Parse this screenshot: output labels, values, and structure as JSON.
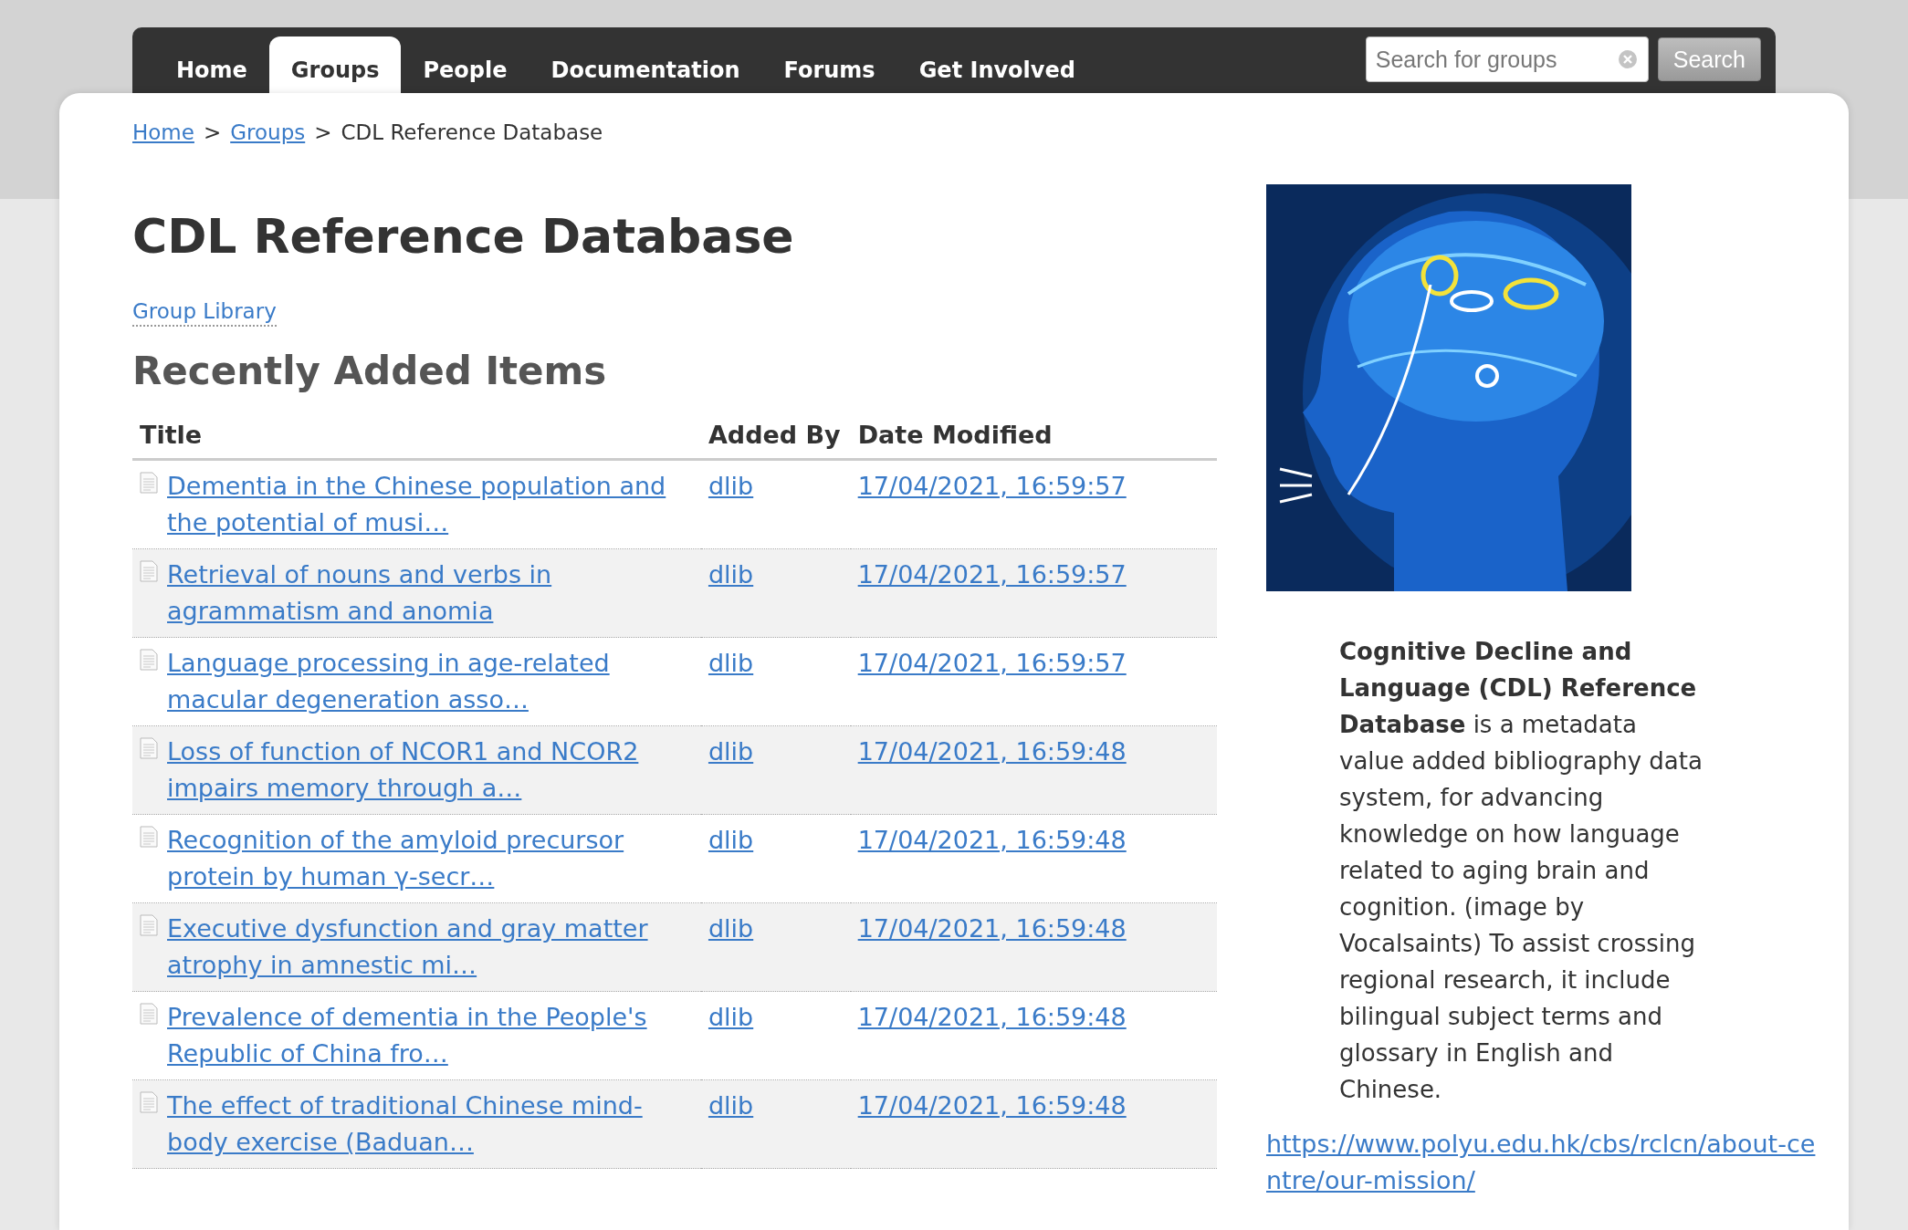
{
  "nav": {
    "items": [
      {
        "label": "Home",
        "selected": false
      },
      {
        "label": "Groups",
        "selected": true
      },
      {
        "label": "People",
        "selected": false
      },
      {
        "label": "Documentation",
        "selected": false
      },
      {
        "label": "Forums",
        "selected": false
      },
      {
        "label": "Get Involved",
        "selected": false
      }
    ],
    "search": {
      "placeholder": "Search for groups",
      "button": "Search"
    }
  },
  "breadcrumb": [
    {
      "kind": "link",
      "label": "Home"
    },
    {
      "kind": "separator",
      "label": ">"
    },
    {
      "kind": "link",
      "label": "Groups"
    },
    {
      "kind": "separator",
      "label": ">"
    },
    {
      "kind": "current",
      "label": "CDL Reference Database"
    }
  ],
  "title": "CDL Reference Database",
  "library_link": "Group Library",
  "section_title": "Recently Added Items",
  "table": {
    "columns": [
      "Title",
      "Added By",
      "Date Modified"
    ],
    "rows": [
      {
        "title": "Dementia in the Chinese population and the potential of musi…",
        "added_by": "dlib",
        "date_modified": "17/04/2021, 16:59:57"
      },
      {
        "title": "Retrieval of nouns and verbs in agrammatism and anomia",
        "added_by": "dlib",
        "date_modified": "17/04/2021, 16:59:57"
      },
      {
        "title": "Language processing in age-related macular degeneration asso…",
        "added_by": "dlib",
        "date_modified": "17/04/2021, 16:59:57"
      },
      {
        "title": "Loss of function of NCOR1 and NCOR2 impairs memory through a…",
        "added_by": "dlib",
        "date_modified": "17/04/2021, 16:59:48"
      },
      {
        "title": "Recognition of the amyloid precursor protein by human γ-secr…",
        "added_by": "dlib",
        "date_modified": "17/04/2021, 16:59:48"
      },
      {
        "title": "Executive dysfunction and gray matter atrophy in amnestic mi…",
        "added_by": "dlib",
        "date_modified": "17/04/2021, 16:59:48"
      },
      {
        "title": "Prevalence of dementia in the People's Republic of China fro…",
        "added_by": "dlib",
        "date_modified": "17/04/2021, 16:59:48"
      },
      {
        "title": "The effect of traditional Chinese mind-body exercise (Baduan…",
        "added_by": "dlib",
        "date_modified": "17/04/2021, 16:59:48"
      }
    ]
  },
  "sidebar": {
    "description": "**Cognitive Decline and Language (CDL) Reference Database** is a metadata value added bibliography data system, for advancing knowledge on how language related to aging brain and cognition. (image by Vocalsaints) To assist crossing regional research, it include bilingual subject terms and glossary in English and Chinese.",
    "link": "https://www.polyu.edu.hk/cbs/rclcn/about-centre/our-mission/"
  }
}
